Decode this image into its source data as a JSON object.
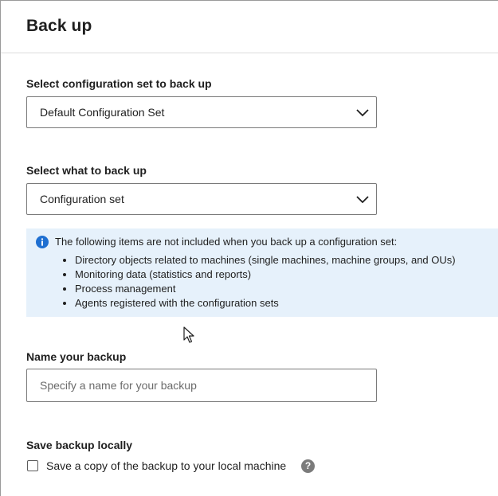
{
  "header": {
    "title": "Back up"
  },
  "config_set": {
    "label": "Select configuration set to back up",
    "selected": "Default Configuration Set"
  },
  "backup_what": {
    "label": "Select what to back up",
    "selected": "Configuration set"
  },
  "info": {
    "lead": "The following items are not included when you back up a configuration set:",
    "items": [
      "Directory objects related to machines (single machines, machine groups, and OUs)",
      "Monitoring data (statistics and reports)",
      "Process management",
      "Agents registered with the configuration sets"
    ]
  },
  "backup_name": {
    "label": "Name your backup",
    "value": "",
    "placeholder": "Specify a name for your backup"
  },
  "save_local": {
    "label": "Save backup locally",
    "checkbox_label": "Save a copy of the backup to your local machine",
    "help_glyph": "?"
  },
  "colors": {
    "info_background": "#e6f1fb",
    "info_icon": "#1e6fd1",
    "border": "#7a7a7a"
  }
}
